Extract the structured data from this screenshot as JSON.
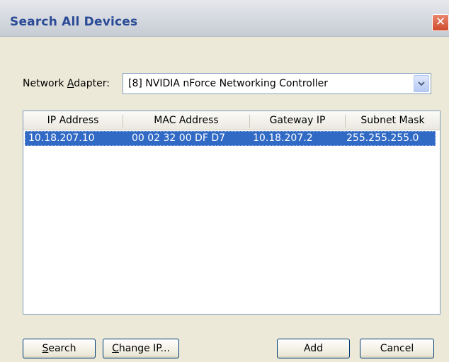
{
  "window": {
    "title": "Search All Devices",
    "close_glyph": "✕"
  },
  "adapter": {
    "label_pre": "Network ",
    "label_accel": "A",
    "label_post": "dapter:",
    "selected": "[8] NVIDIA nForce Networking Controller"
  },
  "table": {
    "columns": [
      "IP Address",
      "MAC Address",
      "Gateway IP",
      "Subnet Mask"
    ],
    "rows": [
      {
        "ip": "10.18.207.10",
        "mac": "00 02 32 00 DF D7",
        "gateway": "10.18.207.2",
        "subnet": "255.255.255.0",
        "selected": true
      }
    ]
  },
  "buttons": {
    "search_accel": "S",
    "search_rest": "earch",
    "change_ip_accel": "C",
    "change_ip_rest": "hange IP...",
    "add": "Add",
    "cancel": "Cancel"
  },
  "colors": {
    "selection": "#316ac5",
    "title_text": "#2a4a96",
    "dialog_bg": "#ece9d8"
  }
}
